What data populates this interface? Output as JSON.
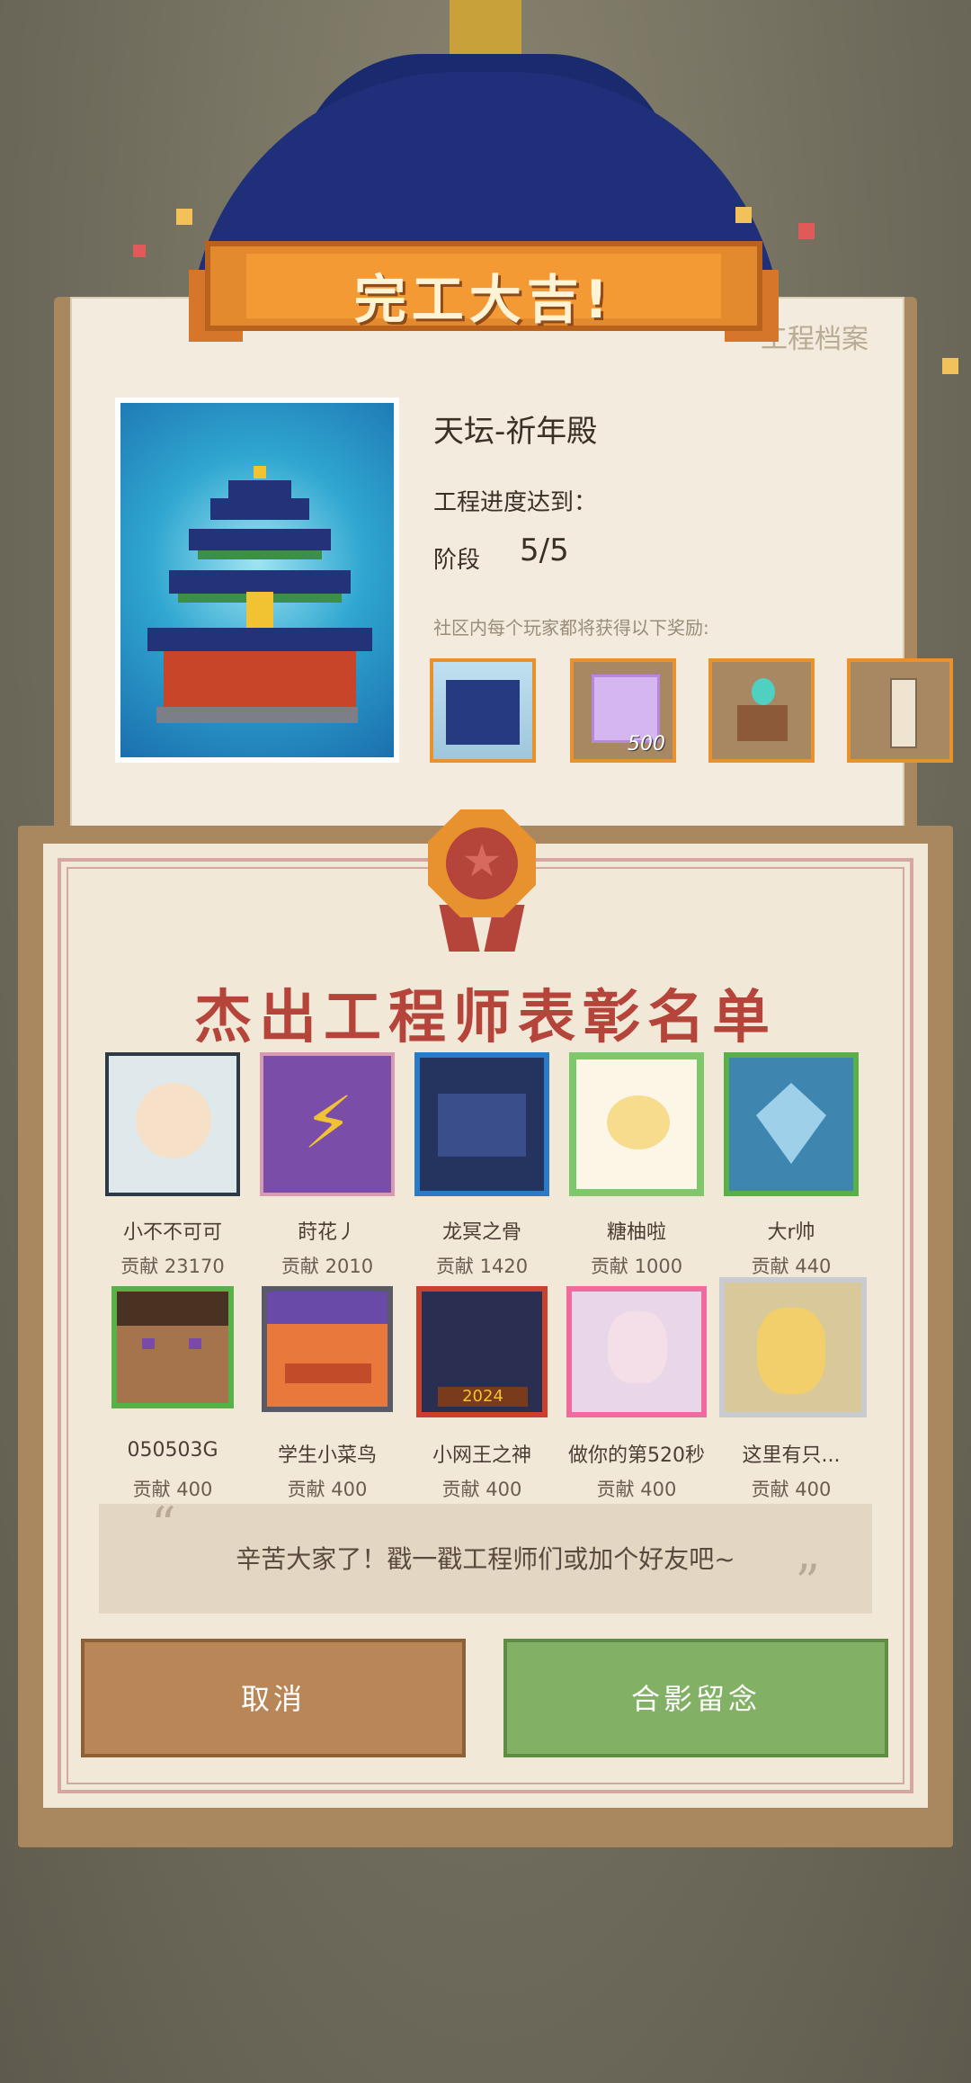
{
  "header": {
    "banner_title": "完工大吉!",
    "archive_tab": "工程档案"
  },
  "project": {
    "name": "天坛-祈年殿",
    "progress_label": "工程进度达到：",
    "stage_label": "阶段",
    "stage_value": "5/5",
    "reward_note": "社区内每个玩家都将获得以下奖励:",
    "rewards": [
      {
        "icon": "temple-of-heaven-model-icon",
        "qty": ""
      },
      {
        "icon": "purple-cube-icon",
        "qty": "500"
      },
      {
        "icon": "crafting-table-icon",
        "qty": ""
      },
      {
        "icon": "scroll-banner-icon",
        "qty": ""
      }
    ]
  },
  "honor": {
    "heading": "杰出工程师表彰名单",
    "engineers": [
      {
        "name": "小不不可可",
        "contribution": "贡献 23170"
      },
      {
        "name": "莳花丿",
        "contribution": "贡献 2010"
      },
      {
        "name": "龙冥之骨",
        "contribution": "贡献 1420"
      },
      {
        "name": "糖柚啦",
        "contribution": "贡献 1000"
      },
      {
        "name": "大r帅",
        "contribution": "贡献 440"
      },
      {
        "name": "050503G",
        "contribution": "贡献 400"
      },
      {
        "name": "学生小菜鸟",
        "contribution": "贡献 400"
      },
      {
        "name": "小网王之神",
        "contribution": "贡献 400"
      },
      {
        "name": "做你的第520秒",
        "contribution": "贡献 400"
      },
      {
        "name": "这里有只...",
        "contribution": "贡献 400"
      }
    ],
    "message": "辛苦大家了！戳一戳工程师们或加个好友吧~"
  },
  "buttons": {
    "cancel": "取消",
    "photo": "合影留念"
  },
  "colors": {
    "accent_orange": "#e7912f",
    "heading_red": "#b5443a",
    "confirm_green": "#82b064",
    "cancel_brown": "#b98657"
  }
}
